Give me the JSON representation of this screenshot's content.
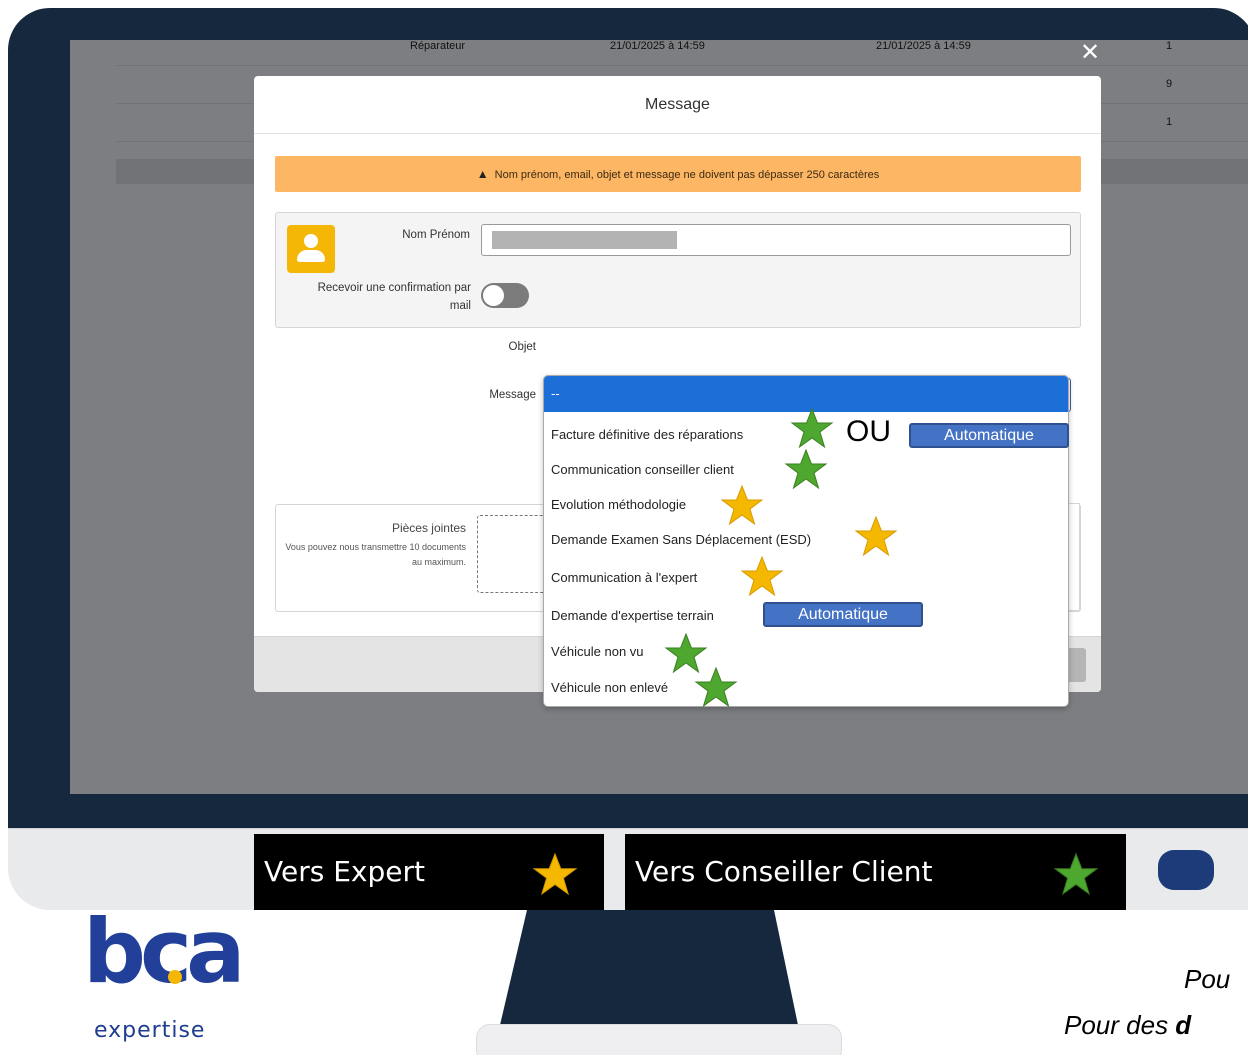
{
  "background_table": {
    "row0": {
      "col_a": "Réparateur",
      "col_b": "21/01/2025 à 14:59",
      "col_c": "21/01/2025 à 14:59",
      "count": "1"
    },
    "row1": {
      "count": "9"
    },
    "row2": {
      "count": "1"
    }
  },
  "close_label": "✕",
  "modal": {
    "title": "Message",
    "warning_icon": "warning-triangle",
    "warning_text": "Nom prénom, email, objet et message ne doivent pas dépasser 250 caractères",
    "nom_prenom_label": "Nom Prénom",
    "confirmation_label": "Recevoir une confirmation par mail",
    "objet_label": "Objet",
    "objet_value": "--",
    "message_label": "Message",
    "pieces_label": "Pièces jointes",
    "pieces_desc": "Vous pouvez nous transmettre 10 documents au maximum."
  },
  "dropdown": {
    "options": [
      "--",
      "Facture définitive des réparations",
      "Communication conseiller client",
      "Evolution méthodologie",
      "Demande Examen Sans Déplacement (ESD)",
      "Communication à l'expert",
      "Demande d'expertise terrain",
      "Véhicule non vu",
      "Véhicule non enlevé"
    ],
    "selected": "--"
  },
  "annotations": {
    "ou": "OU",
    "automatique": "Automatique",
    "star_colors": {
      "expert": "#f5b800",
      "conseiller": "#4ea72e"
    }
  },
  "legend": {
    "expert": "Vers Expert",
    "conseiller": "Vers Conseiller Client"
  },
  "logo": {
    "word": "bca",
    "sub": "expertise"
  },
  "notes": {
    "line1": "Pou",
    "line2_prefix": "Pour des ",
    "line2_bold": "d"
  },
  "colors": {
    "frame": "#16283d",
    "warning": "#fcb664",
    "selected": "#1c6fd6",
    "badge": "#4472c4",
    "avatar": "#f5b706"
  }
}
